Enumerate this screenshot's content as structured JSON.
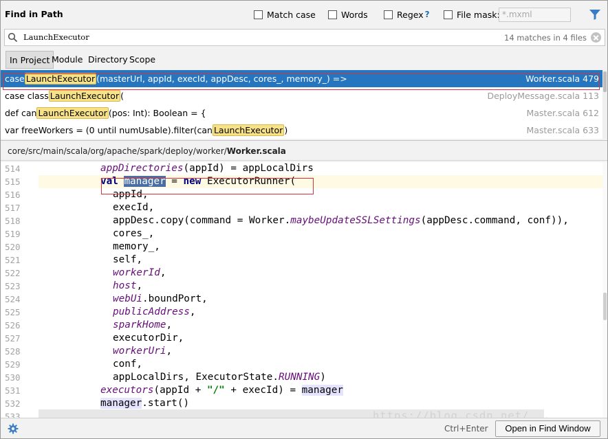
{
  "header": {
    "title": "Find in Path",
    "options": [
      {
        "label": "Match case",
        "checked": false
      },
      {
        "label": "Words",
        "checked": false
      },
      {
        "label": "Regex",
        "checked": false
      },
      {
        "label": "File mask:",
        "checked": false
      }
    ],
    "regex_help": "?",
    "file_mask_placeholder": "*.mxml"
  },
  "search": {
    "query": "LaunchExecutor",
    "match_count": "14 matches in 4 files"
  },
  "scopes": [
    "In Project",
    "Module",
    "Directory",
    "Scope"
  ],
  "results": [
    {
      "pre": "case ",
      "hit": "LaunchExecutor",
      "post": "(masterUrl, appId, execId, appDesc, cores_, memory_) =>",
      "file": "Worker.scala 479"
    },
    {
      "pre": "case class ",
      "hit": "LaunchExecutor",
      "post": "(",
      "file": "DeployMessage.scala 113"
    },
    {
      "pre": "def can",
      "hit": "LaunchExecutor",
      "post": "(pos: Int): Boolean = {",
      "file": "Master.scala 612"
    },
    {
      "pre": "var freeWorkers = (0 until numUsable).filter(can",
      "hit": "LaunchExecutor",
      "post": ")",
      "file": "Master.scala 633"
    }
  ],
  "path": {
    "dir": "core/src/main/scala/org/apache/spark/deploy/worker/",
    "file": "Worker.scala"
  },
  "code": {
    "line_numbers": [
      "514",
      "515",
      "516",
      "517",
      "518",
      "519",
      "520",
      "521",
      "522",
      "523",
      "524",
      "525",
      "526",
      "527",
      "528",
      "529",
      "530",
      "531",
      "532",
      "533"
    ],
    "lines": {
      "l514": {
        "mem": "appDirectories",
        "rest": "(appId) = appLocalDirs"
      },
      "l515": {
        "kw1": "val",
        "sel": "manager",
        "eq": " = ",
        "kw2": "new",
        "rest": " ExecutorRunner("
      },
      "l516": {
        "text": "appId,"
      },
      "l517": {
        "text": "execId,"
      },
      "l518": {
        "pre": "appDesc.copy(command = Worker.",
        "mem": "maybeUpdateSSLSettings",
        "post": "(appDesc.command, conf)),"
      },
      "l519": {
        "text": "cores_,"
      },
      "l520": {
        "text": "memory_,"
      },
      "l521": {
        "text": "self,"
      },
      "l522": {
        "mem": "workerId",
        "post": ","
      },
      "l523": {
        "mem": "host",
        "post": ","
      },
      "l524": {
        "mem": "webUi",
        "post": ".boundPort,"
      },
      "l525": {
        "mem": "publicAddress",
        "post": ","
      },
      "l526": {
        "mem": "sparkHome",
        "post": ","
      },
      "l527": {
        "text": "executorDir,"
      },
      "l528": {
        "mem": "workerUri",
        "post": ","
      },
      "l529": {
        "text": "conf,"
      },
      "l530": {
        "pre": "appLocalDirs, ExecutorState.",
        "mem": "RUNNING",
        "post": ")"
      },
      "l531": {
        "mem": "executors",
        "mid": "(appId + ",
        "str": "\"/\"",
        "mid2": " + execId) = ",
        "ref": "manager"
      },
      "l532": {
        "ref": "manager",
        "post": ".start()"
      }
    },
    "watermark": "https://blog.csdn.net/..."
  },
  "footer": {
    "shortcut": "Ctrl+Enter",
    "open_button": "Open in Find Window"
  },
  "colors": {
    "selection": "#2675bf",
    "highlight": "#f8e288",
    "keyword": "#000080",
    "member": "#660e7a",
    "string": "#008000",
    "annotation_box": "#d9323c"
  }
}
